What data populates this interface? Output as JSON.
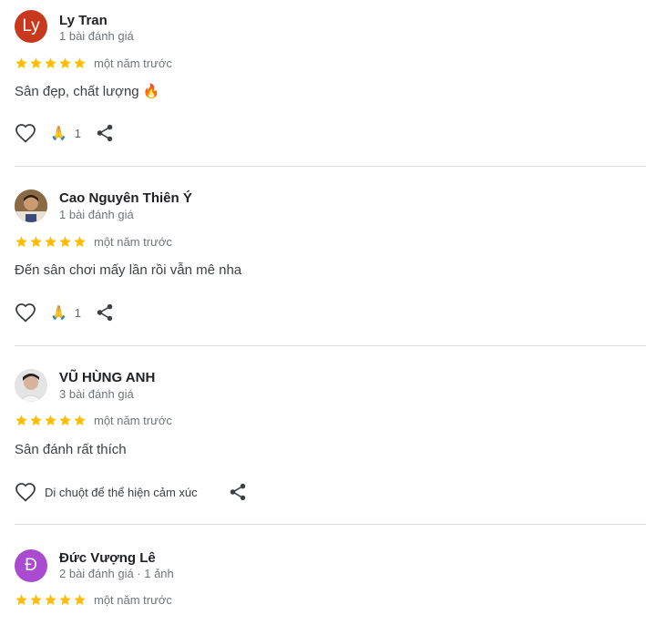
{
  "reviews": [
    {
      "name": "Ly Tran",
      "avatar_letter": "Ly",
      "meta": "1 bài đánh giá",
      "stars": 5,
      "time": "một năm trước",
      "text": "Sân đẹp, chất lượng 🔥",
      "reaction_emoji": "🙏",
      "reaction_count": "1"
    },
    {
      "name": "Cao Nguyên Thiên Ý",
      "meta": "1 bài đánh giá",
      "stars": 5,
      "time": "một năm trước",
      "text": "Đến sân chơi mấy lần rồi vẫn mê nha",
      "reaction_emoji": "🙏",
      "reaction_count": "1"
    },
    {
      "name": "VŨ HÙNG ANH",
      "meta": "3 bài đánh giá",
      "stars": 5,
      "time": "một năm trước",
      "text": "Sân đánh rất thích",
      "hover_hint": "Di chuột để thể hiện cảm xúc"
    },
    {
      "name": "Đức Vượng Lê",
      "avatar_letter": "Đ",
      "meta": "2 bài đánh giá · 1 ảnh",
      "stars": 5,
      "time": "một năm trước"
    }
  ],
  "colors": {
    "star": "#fbbc04",
    "avatar_ly": "#c8381c",
    "avatar_d": "#a94ad0",
    "divider": "#dadce0",
    "secondary_text": "#70757a"
  },
  "icons": {
    "like": "heart-outline-icon",
    "share": "share-icon",
    "star": "star-icon"
  }
}
